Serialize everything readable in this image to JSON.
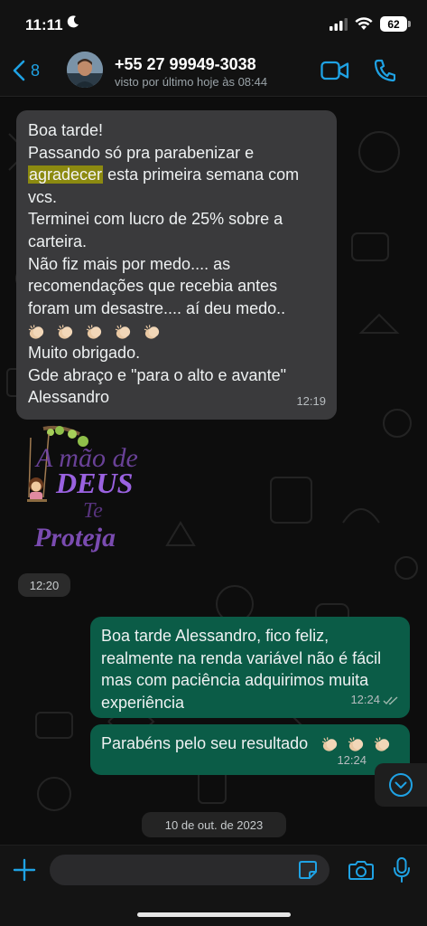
{
  "status_bar": {
    "time": "11:11",
    "moon_icon": "moon-icon",
    "battery": "62",
    "icons": [
      "cellular-signal-icon",
      "wifi-icon",
      "battery-icon"
    ]
  },
  "header": {
    "back_count": "8",
    "contact_name": "+55 27 99949-3038",
    "contact_status": "visto por último hoje às 08:44",
    "icons": [
      "chevron-left-icon",
      "video-call-icon",
      "phone-call-icon"
    ]
  },
  "messages": {
    "incoming_1": {
      "lines": [
        "Boa tarde!",
        "Passando só pra parabenizar e",
        "agradecer",
        " esta primeira semana com",
        "vcs.",
        "Terminei com lucro de 25% sobre a",
        "carteira.",
        "Não fiz mais por medo.... as",
        "recomendações que recebia antes",
        "foram um desastre.... aí deu medo..",
        "Muito obrigado.",
        "Gde abraço e \"para o alto e avante\"",
        "Alessandro"
      ],
      "time": "12:19"
    },
    "sticker": {
      "text_line1": "A mão de",
      "text_line2": "DEUS",
      "text_line3": "Te",
      "text_line4": "Proteja",
      "time": "12:20"
    },
    "outgoing_1": {
      "lines": [
        "Boa tarde Alessandro, fico feliz,",
        "realmente na renda variável não é fácil",
        "mas com paciência adquirimos muita",
        "experiência"
      ],
      "time": "12:24"
    },
    "outgoing_2": {
      "text": "Parabéns pelo seu resultado",
      "time": "12:24"
    }
  },
  "date_divider": "10 de out. de 2023",
  "input_bar": {
    "placeholder": "",
    "icons": [
      "plus-icon",
      "sticker-icon",
      "camera-icon",
      "microphone-icon"
    ]
  },
  "colors": {
    "accent": "#1fa2e4",
    "incoming_bubble": "#3a3a3c",
    "outgoing_bubble": "#0b5c47",
    "highlight": "#8c8a10"
  }
}
